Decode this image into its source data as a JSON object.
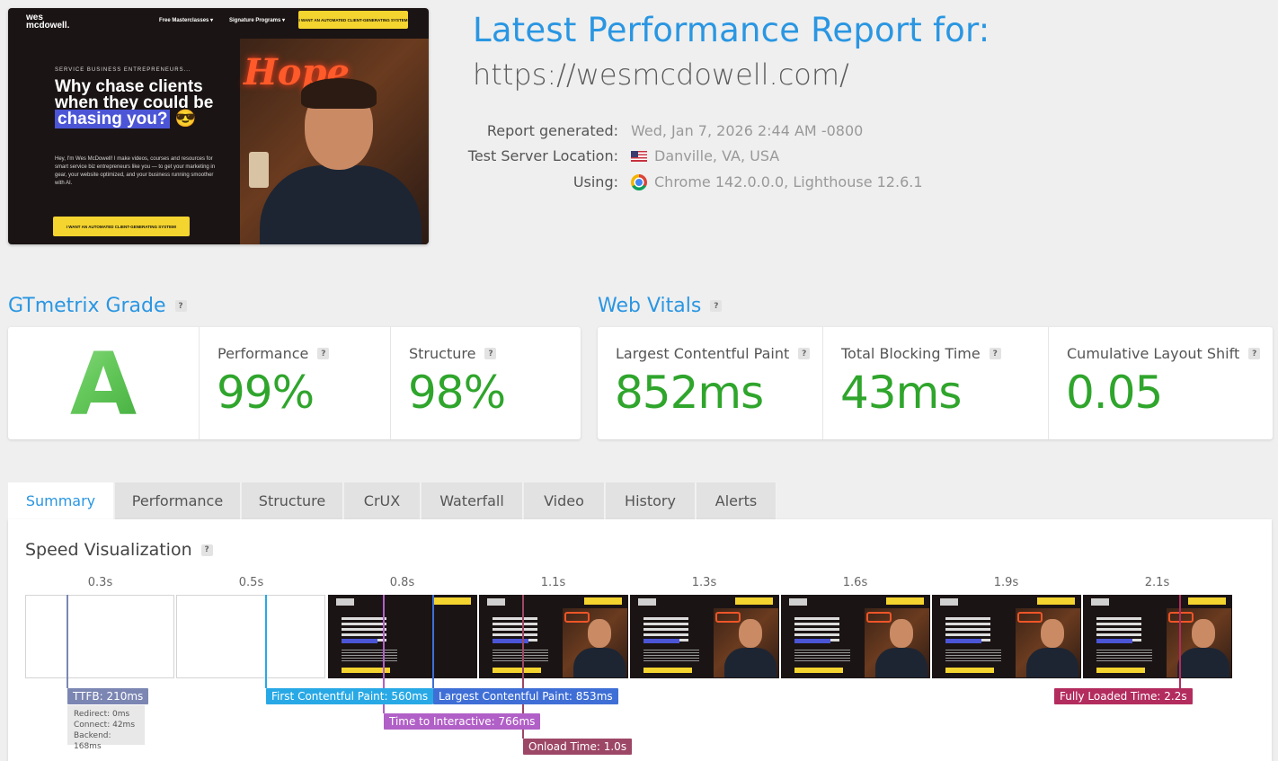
{
  "screenshot": {
    "logo": "wes mcdowell.",
    "nav": [
      "Free Masterclasses ▾",
      "Signature Programs ▾"
    ],
    "top_cta": "I WANT AN AUTOMATED CLIENT-GENERATING SYSTEM",
    "eyebrow": "SERVICE BUSINESS ENTREPRENEURS...",
    "headline_plain": "Why chase clients when they could be",
    "headline_highlight": "chasing you?",
    "emoji": "😎",
    "body": "Hey, I'm Wes McDowell! I make videos, courses and resources for smart service biz entrepreneurs like you — to get your marketing in gear, your website optimized, and your business running smoother with AI.",
    "cta": "I WANT AN AUTOMATED CLIENT-GENERATING SYSTEM!",
    "neon": "Hope"
  },
  "report": {
    "title": "Latest Performance Report for:",
    "url": "https://wesmcdowell.com/",
    "generated_label": "Report generated:",
    "generated_value": "Wed, Jan 7, 2026 2:44 AM -0800",
    "location_label": "Test Server Location:",
    "location_value": "Danville, VA, USA",
    "using_label": "Using:",
    "using_value": "Chrome 142.0.0.0, Lighthouse 12.6.1"
  },
  "grade": {
    "section_title": "GTmetrix Grade",
    "letter": "A",
    "performance_label": "Performance",
    "performance_value": "99%",
    "structure_label": "Structure",
    "structure_value": "98%"
  },
  "vitals": {
    "section_title": "Web Vitals",
    "lcp_label": "Largest Contentful Paint",
    "lcp_value": "852ms",
    "tbt_label": "Total Blocking Time",
    "tbt_value": "43ms",
    "cls_label": "Cumulative Layout Shift",
    "cls_value": "0.05"
  },
  "tabs": [
    "Summary",
    "Performance",
    "Structure",
    "CrUX",
    "Waterfall",
    "Video",
    "History",
    "Alerts"
  ],
  "active_tab": "Summary",
  "speed": {
    "title": "Speed Visualization",
    "frame_times": [
      "0.3s",
      "0.5s",
      "0.8s",
      "1.1s",
      "1.3s",
      "1.6s",
      "1.9s",
      "2.1s"
    ],
    "markers": {
      "ttfb": "TTFB: 210ms",
      "fcp": "First Contentful Paint: 560ms",
      "lcp": "Largest Contentful Paint: 853ms",
      "tti": "Time to Interactive: 766ms",
      "onload": "Onload Time: 1.0s",
      "fully_loaded": "Fully Loaded Time: 2.2s"
    },
    "ttfb_detail": {
      "redirect": "Redirect: 0ms",
      "connect": "Connect: 42ms",
      "backend": "Backend: 168ms"
    }
  },
  "colors": {
    "accent": "#2a96e2",
    "good": "#2fa52c",
    "ttfb": "#7b86b3",
    "fcp": "#28a9e6",
    "lcp": "#3f6fd6",
    "tti": "#b160c7",
    "onload": "#9d4766",
    "fully_loaded": "#b32c5e"
  }
}
